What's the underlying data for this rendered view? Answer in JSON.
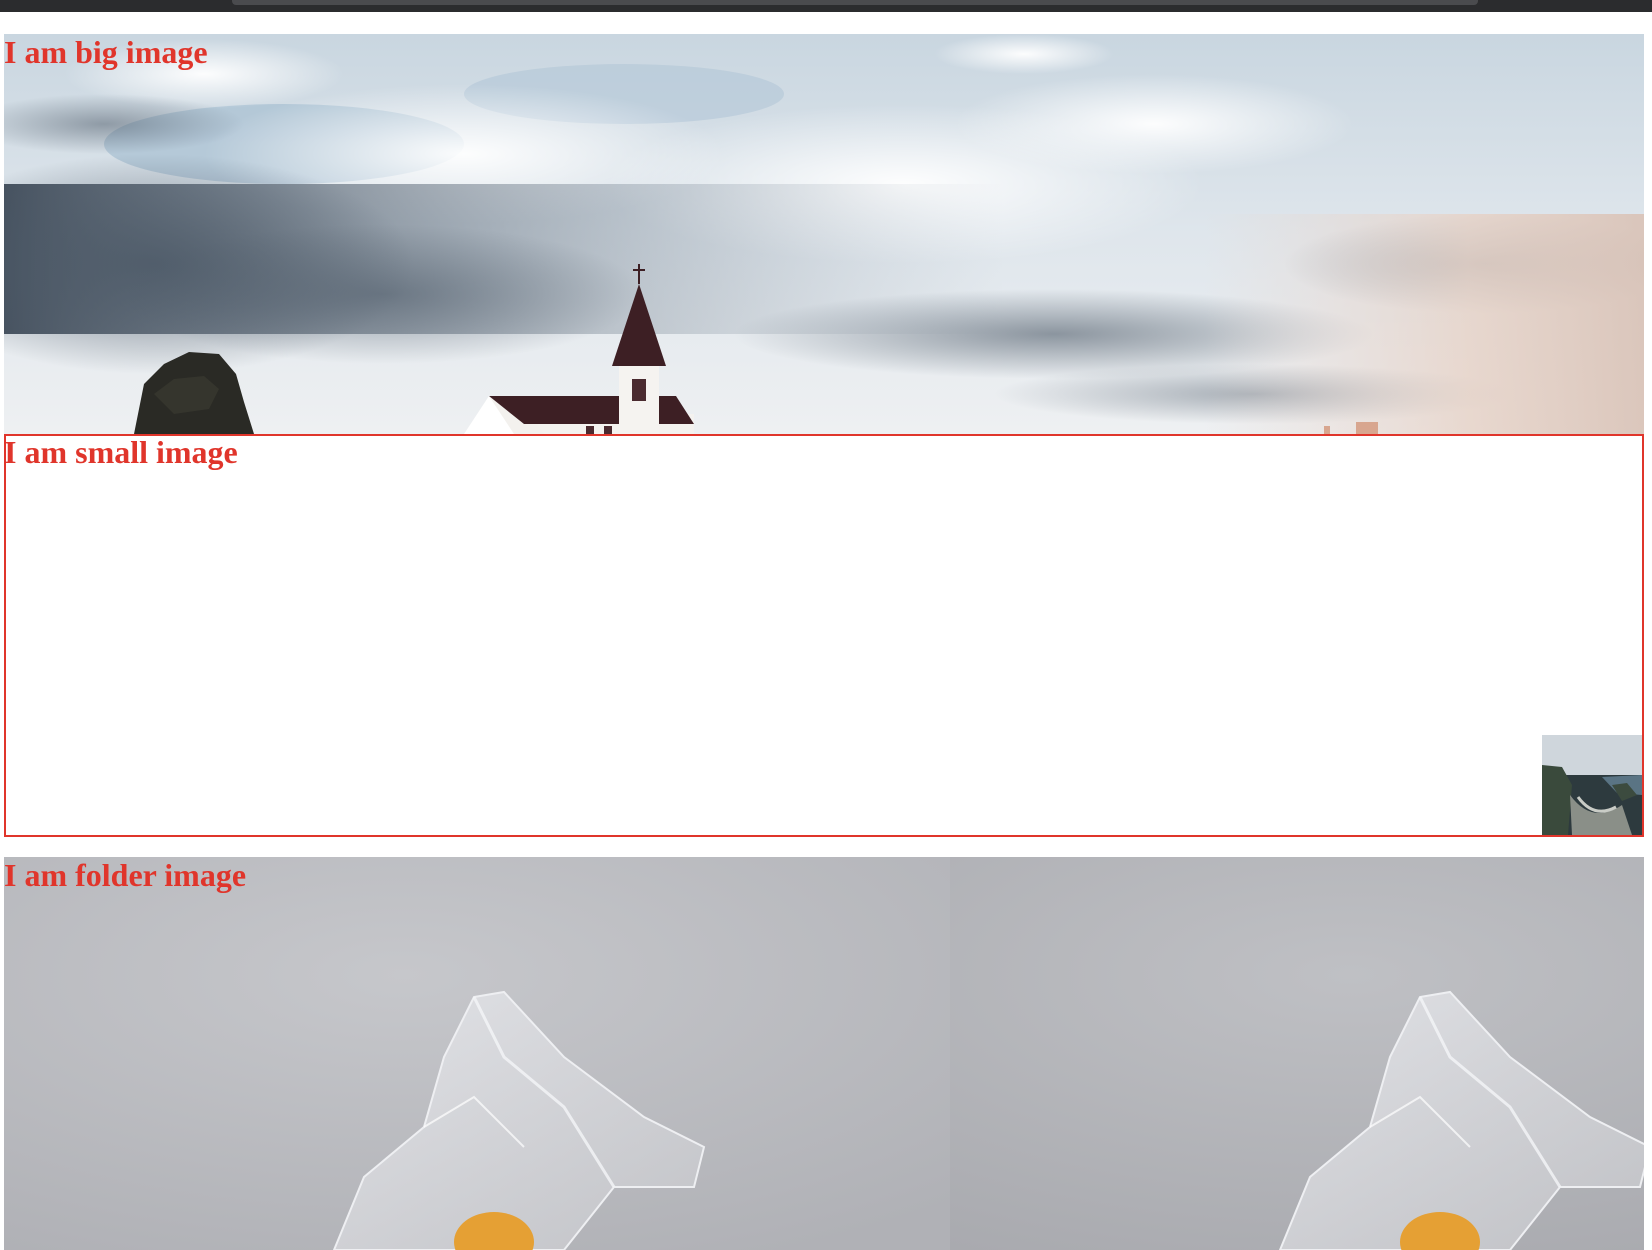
{
  "sections": {
    "big": {
      "heading": "I am big image"
    },
    "small": {
      "heading": "I am small image"
    },
    "folder": {
      "heading": "I am folder image"
    }
  },
  "colors": {
    "heading": "#e0352b",
    "border": "#e0352b",
    "browser_bar": "#2b2c2e"
  },
  "images": {
    "big": "landscape-church-sky",
    "small": "coastal-cliff-thumbnail",
    "folder": "plastic-bag-orange-on-grey"
  }
}
